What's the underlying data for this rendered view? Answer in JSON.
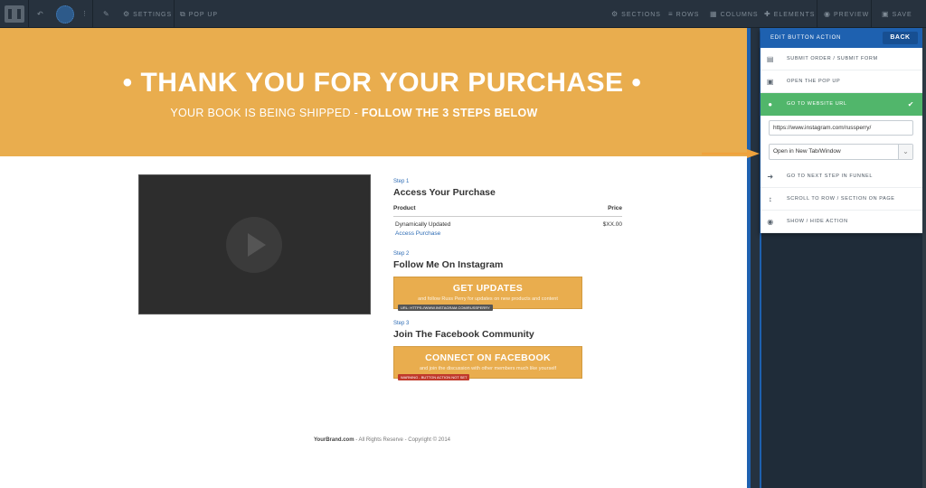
{
  "toolbar": {
    "settings_label": "SETTINGS",
    "popup_label": "POP UP",
    "sections_label": "SECTIONS",
    "rows_label": "ROWS",
    "columns_label": "COLUMNS",
    "elements_label": "ELEMENTS",
    "preview_label": "PREVIEW",
    "save_label": "SAVE"
  },
  "hero": {
    "title": "• THANK YOU FOR YOUR PURCHASE •",
    "subtitle_plain": "YOUR BOOK IS BEING SHIPPED - ",
    "subtitle_bold": "FOLLOW THE 3 STEPS BELOW"
  },
  "step1": {
    "label": "Step 1",
    "title": "Access Your Purchase",
    "col_product": "Product",
    "col_price": "Price",
    "product_name": "Dynamically Updated",
    "product_link": "Access Purchase",
    "product_price": "$XX.00"
  },
  "step2": {
    "label": "Step 2",
    "title": "Follow Me On Instagram",
    "button_main": "GET UPDATES",
    "button_sub": "and follow Russ Perry for updates on new products and content",
    "tag": "URL: HTTPS://WWW.INSTAGRAM.COM/RUSSPERRY"
  },
  "step3": {
    "label": "Step 3",
    "title": "Join The Facebook Community",
    "button_main": "CONNECT ON FACEBOOK",
    "button_sub": "and join the discussion with other members much like yourself",
    "tag": "WARNING - BUTTON ACTION NOT SET"
  },
  "footer": {
    "brand": "YourBrand.com",
    "text": " - All Rights Reserve - Copyright © 2014"
  },
  "panel": {
    "title": "EDIT BUTTON ACTION",
    "back_label": "BACK",
    "items": [
      {
        "label": "SUBMIT ORDER / SUBMIT FORM",
        "icon": "form-icon"
      },
      {
        "label": "OPEN THE POP UP",
        "icon": "popup-icon"
      },
      {
        "label": "GO TO WEBSITE URL",
        "icon": "globe-icon"
      },
      {
        "label": "GO TO NEXT STEP IN FUNNEL",
        "icon": "arrow-right-icon"
      },
      {
        "label": "SCROLL TO ROW / SECTION ON PAGE",
        "icon": "scroll-icon"
      },
      {
        "label": "SHOW / HIDE ACTION",
        "icon": "eye-icon"
      }
    ],
    "url_value": "https://www.instagram.com/russperry/",
    "target_select": "Open in New Tab/Window"
  },
  "colors": {
    "hero": "#e9ad4e",
    "panel_accent": "#1e61b0",
    "active_item": "#51b66b",
    "arrow": "#f0a23c",
    "warning": "#c0392b"
  }
}
